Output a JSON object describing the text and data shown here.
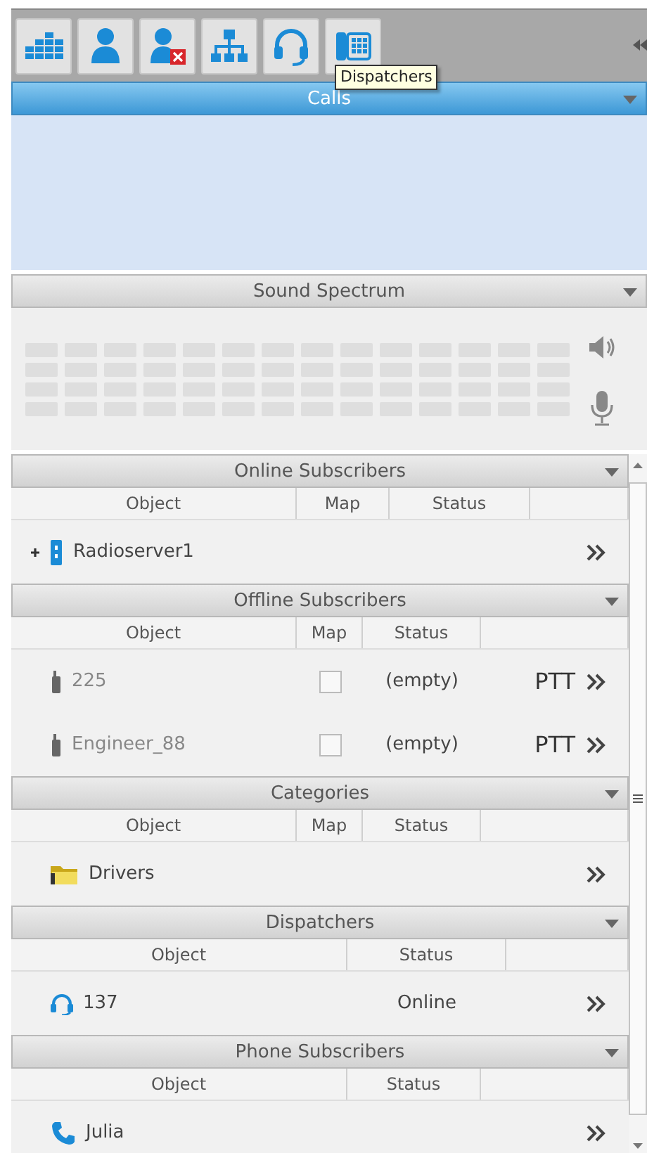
{
  "toolbar": {
    "buttons": [
      {
        "kind": "spectrum"
      },
      {
        "kind": "user"
      },
      {
        "kind": "user-blocked"
      },
      {
        "kind": "hierarchy"
      },
      {
        "kind": "headset"
      },
      {
        "kind": "desk-phone"
      }
    ],
    "tooltip": "Dispatchers"
  },
  "calls": {
    "title": "Calls",
    "active": true
  },
  "sound": {
    "title": "Sound Spectrum",
    "active": false
  },
  "sections": [
    {
      "title": "Online Subscribers",
      "active": false,
      "columns": [
        "Object",
        "Map",
        "Status"
      ],
      "rows": [
        {
          "kind": "radio-server",
          "name": "Radioserver1",
          "expanded": false,
          "offline": false
        }
      ]
    },
    {
      "title": "Offline Subscribers",
      "active": false,
      "columns": [
        "Object",
        "Map",
        "Status"
      ],
      "rows": [
        {
          "kind": "radio",
          "name": "225",
          "offline": true,
          "map": {
            "checked": false
          },
          "status": "(empty)",
          "action": "PTT"
        },
        {
          "kind": "radio",
          "name": "Engineer_88",
          "offline": true,
          "map": {
            "checked": false
          },
          "status": "(empty)",
          "action": "PTT"
        }
      ]
    },
    {
      "title": "Categories",
      "active": false,
      "columns": [
        "Object",
        "Map",
        "Status"
      ],
      "rows": [
        {
          "kind": "folder",
          "name": "Drivers",
          "offline": false
        }
      ]
    },
    {
      "title": "Dispatchers",
      "active": false,
      "columns": [
        "Object",
        "Status"
      ],
      "rows": [
        {
          "kind": "headset",
          "name": "137",
          "offline": false,
          "status": "Online"
        }
      ]
    },
    {
      "title": "Phone Subscribers",
      "active": false,
      "columns": [
        "Object",
        "Status"
      ],
      "rows": [
        {
          "kind": "phone",
          "name": "Julia",
          "offline": false
        }
      ]
    }
  ]
}
